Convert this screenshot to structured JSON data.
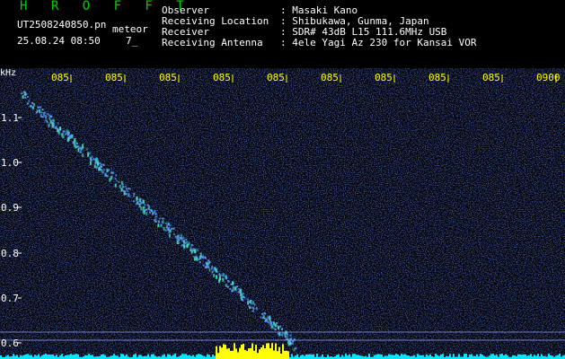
{
  "header": {
    "brand": "H R O F F T",
    "filename": "UT2508240850.pn",
    "type_label": "meteor",
    "datetime": "25.08.24 08:50",
    "count": "7_",
    "observer_label": "Observer",
    "observer_value": ": Masaki Kano",
    "location_label": "Receiving Location",
    "location_value": ": Shibukawa, Gunma, Japan",
    "receiver_label": "Receiver",
    "receiver_value": ": SDR# 43dB L15 111.6MHz USB",
    "antenna_label": "Receiving Antenna",
    "antenna_value": ": 4ele Yagi Az 230 for Kansai VOR"
  },
  "spectrogram": {
    "unit": "kHz",
    "y_ticks": [
      "1.1",
      "1.0",
      "0.9",
      "0.8",
      "0.7",
      "0.6"
    ],
    "x_ticks": [
      "085",
      "085",
      "085",
      "085",
      "085",
      "085",
      "085",
      "085",
      "085",
      "0900"
    ],
    "colors": {
      "background": "#000000",
      "noise": "#1a2aa8",
      "trace": "#40e0c0",
      "baseline": "#00e8ff",
      "burst": "#ffff00",
      "tick_text": "#ffff00",
      "axis_text": "#ffffff"
    }
  }
}
